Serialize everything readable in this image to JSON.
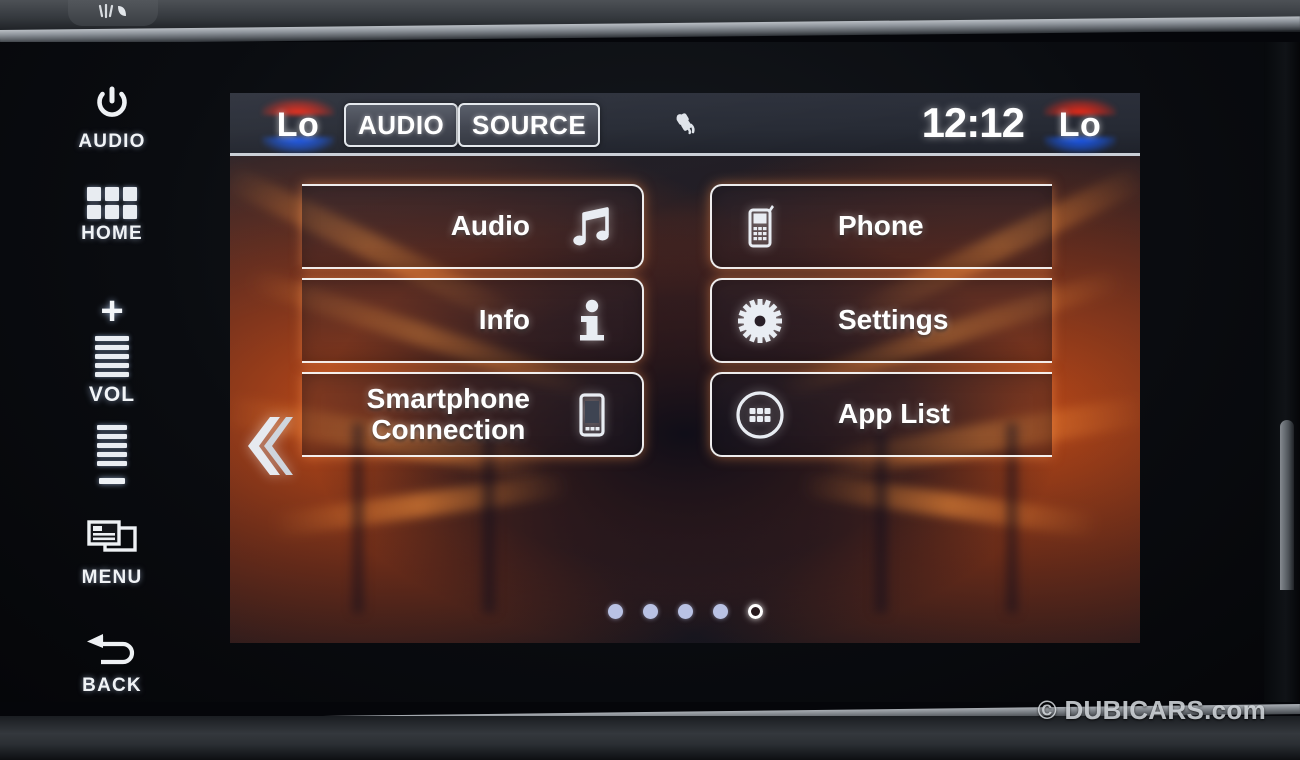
{
  "hardware_buttons": [
    {
      "label": "AUDIO",
      "icon": "power-icon"
    },
    {
      "label": "HOME",
      "icon": "grid-icon"
    },
    {
      "label": "VOL",
      "icon": "volume-slider-icon",
      "plus": "+",
      "minus": "-"
    },
    {
      "label": "MENU",
      "icon": "windows-icon"
    },
    {
      "label": "BACK",
      "icon": "return-arrow-icon"
    }
  ],
  "statusbar": {
    "climate_left": "Lo",
    "climate_right": "Lo",
    "audio_button": "AUDIO",
    "source_button": "SOURCE",
    "satellite_icon": "satellite-icon",
    "clock": "12:12"
  },
  "tiles": {
    "left": [
      {
        "label": "Audio",
        "icon": "music-note-icon"
      },
      {
        "label": "Info",
        "icon": "info-icon"
      },
      {
        "label": "Smartphone\nConnection",
        "line1": "Smartphone",
        "line2": "Connection",
        "icon": "smartphone-icon"
      }
    ],
    "right": [
      {
        "label": "Phone",
        "icon": "cellphone-icon"
      },
      {
        "label": "Settings",
        "icon": "gear-icon"
      },
      {
        "label": "App List",
        "icon": "app-grid-circle-icon"
      }
    ]
  },
  "navigation": {
    "back_chevron": "«",
    "page_count": 5,
    "active_page": 5
  },
  "watermark": "© DUBICARS.com",
  "colors": {
    "accent_orange": "#ff5c12",
    "climate_hot": "#ff2a15",
    "climate_cold": "#1b5cff",
    "screen_bg": "#14161d",
    "text": "#ffffff"
  }
}
